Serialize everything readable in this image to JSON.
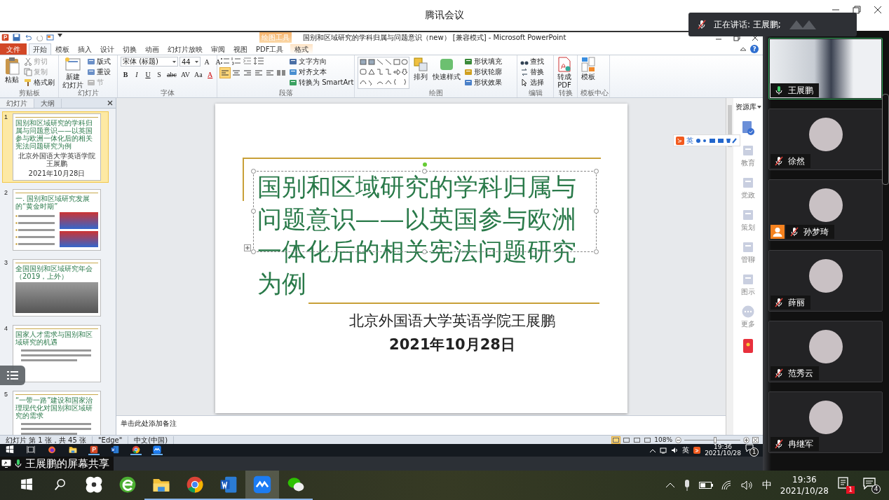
{
  "meeting": {
    "title": "腾讯会议",
    "speaking": {
      "label": "正在讲话: 王展鹏;",
      "mic_muted": true
    }
  },
  "ppt": {
    "title": "国别和区域研究的学科归属与问题意识（new） [兼容模式] - Microsoft PowerPoint",
    "context_group": "绘图工具",
    "help": "?",
    "tabs": [
      {
        "label": "文件",
        "kind": "file",
        "selected": false
      },
      {
        "label": "开始",
        "kind": "normal",
        "selected": true
      },
      {
        "label": "模板",
        "kind": "normal",
        "selected": false
      },
      {
        "label": "插入",
        "kind": "normal",
        "selected": false
      },
      {
        "label": "设计",
        "kind": "normal",
        "selected": false
      },
      {
        "label": "切换",
        "kind": "normal",
        "selected": false
      },
      {
        "label": "动画",
        "kind": "normal",
        "selected": false
      },
      {
        "label": "幻灯片放映",
        "kind": "normal",
        "selected": false
      },
      {
        "label": "审阅",
        "kind": "normal",
        "selected": false
      },
      {
        "label": "视图",
        "kind": "normal",
        "selected": false
      },
      {
        "label": "PDF工具",
        "kind": "normal",
        "selected": false
      },
      {
        "label": "格式",
        "kind": "context",
        "selected": false
      }
    ],
    "ribbon": {
      "clipboard": {
        "label": "剪贴板",
        "paste": "粘贴",
        "items": [
          {
            "label": "剪切",
            "disabled": true
          },
          {
            "label": "复制",
            "disabled": true
          },
          {
            "label": "格式刷",
            "disabled": false
          }
        ]
      },
      "slides": {
        "label": "幻灯片",
        "new_slide": [
          "新建",
          "幻灯片"
        ],
        "items": [
          {
            "label": "版式",
            "disabled": false
          },
          {
            "label": "重设",
            "disabled": false
          },
          {
            "label": "节",
            "disabled": true
          }
        ]
      },
      "font": {
        "label": "字体",
        "name": "宋体 (标题)",
        "size": "44",
        "size_buttons": [
          "A",
          "A"
        ],
        "buttons": [
          "B",
          "I",
          "U",
          "S",
          "abc",
          "AV",
          "Aa",
          "A"
        ]
      },
      "paragraph": {
        "label": "段落",
        "alignments": [
          {
            "selected": true
          },
          {
            "selected": false
          },
          {
            "selected": false
          },
          {
            "selected": false
          },
          {
            "selected": false
          }
        ],
        "items": [
          {
            "label": "文字方向"
          },
          {
            "label": "对齐文本"
          },
          {
            "label": "转换为 SmartArt"
          }
        ]
      },
      "drawing": {
        "label": "绘图",
        "large": [
          "排列",
          "快速样式"
        ],
        "items": [
          {
            "label": "形状填充"
          },
          {
            "label": "形状轮廓"
          },
          {
            "label": "形状效果"
          }
        ]
      },
      "editing": {
        "label": "编辑",
        "items": [
          {
            "label": "查找"
          },
          {
            "label": "替换"
          },
          {
            "label": "选择"
          }
        ]
      },
      "convert": {
        "label": "转换",
        "button": [
          "转成",
          "PDF"
        ]
      },
      "template": {
        "label": "模板中心",
        "button": "模板"
      }
    },
    "pane": {
      "tabs": [
        {
          "label": "幻灯片",
          "selected": true
        },
        {
          "label": "大纲",
          "selected": false
        }
      ],
      "thumbnails": [
        {
          "number": "1",
          "kind": "title",
          "selected": true,
          "title": "国别和区域研究的学科归属与问题意识——以英国参与欧洲一体化后的相关宪法问题研究为例",
          "lines": [
            "北京外国语大学英语学院王展鹏",
            "2021年10月28日"
          ]
        },
        {
          "number": "2",
          "kind": "photos",
          "selected": false,
          "title": "一. 国别和区域研究发展的“黄金时期”"
        },
        {
          "number": "3",
          "kind": "photo",
          "selected": false,
          "title": "全国国别和区域研究年会（2019，上外）"
        },
        {
          "number": "4",
          "kind": "text",
          "selected": false,
          "title": "国家人才需求与国别和区域研究的机遇"
        },
        {
          "number": "5",
          "kind": "text",
          "selected": false,
          "title": "“一带一路”建设和国家治理现代化对国别和区域研究的需求"
        }
      ]
    },
    "slide": {
      "title": "国别和区域研究的学科归属与问题意识——以英国参与欧洲一体化后的相关宪法问题研究为例",
      "subtitle": "北京外国语大学英语学院王展鹏",
      "date": "2021年10月28日"
    },
    "notes_placeholder": "单击此处添加备注",
    "library": {
      "title": "资源库",
      "items": [
        {
          "label": "教育"
        },
        {
          "label": "党政"
        },
        {
          "label": "策划"
        },
        {
          "label": "管聊"
        },
        {
          "label": "图示"
        },
        {
          "label": "更多"
        }
      ]
    },
    "status": {
      "items": [
        "幻灯片 第 1 张，共 45 张",
        "\"Edge\"",
        "中文(中国)"
      ],
      "views": [
        {
          "selected": true
        },
        {
          "selected": false
        },
        {
          "selected": false
        },
        {
          "selected": false
        }
      ],
      "zoom": "108%",
      "zoom_slider": {
        "level": 0.55
      }
    },
    "ime_toolbar": {
      "label": "英"
    }
  },
  "remote_taskbar": {
    "apps": [
      {
        "kind": "start",
        "running": false
      },
      {
        "kind": "taskview",
        "running": false
      },
      {
        "kind": "firefox",
        "running": false
      },
      {
        "kind": "folder",
        "running": false
      },
      {
        "kind": "ppt",
        "running": true
      },
      {
        "kind": "word",
        "running": false
      },
      {
        "kind": "chrome",
        "running": true
      },
      {
        "kind": "meeting",
        "running": true
      }
    ],
    "ime": "英",
    "time": "19:36",
    "date": "2021/10/28",
    "notifications": "1"
  },
  "share_label": "王展鹏的屏幕共享",
  "participants": [
    {
      "name": "王展鹏",
      "kind": "video",
      "muted": false,
      "speaking": true,
      "role_badge": false
    },
    {
      "name": "徐然",
      "kind": "avatar",
      "muted": true,
      "speaking": false,
      "role_badge": false
    },
    {
      "name": "孙梦琦",
      "kind": "avatar",
      "muted": true,
      "speaking": false,
      "role_badge": true
    },
    {
      "name": "薛丽",
      "kind": "avatar",
      "muted": true,
      "speaking": false,
      "role_badge": false
    },
    {
      "name": "范秀云",
      "kind": "avatar",
      "muted": true,
      "speaking": false,
      "role_badge": false
    },
    {
      "name": "冉继军",
      "kind": "avatar",
      "muted": true,
      "speaking": false,
      "role_badge": false
    }
  ],
  "taskbar": {
    "apps": [
      {
        "kind": "start",
        "running": false,
        "selected": false
      },
      {
        "kind": "search",
        "running": false,
        "selected": false
      },
      {
        "kind": "pinwheel",
        "running": false,
        "selected": false
      },
      {
        "kind": "ie",
        "running": false,
        "selected": false
      },
      {
        "kind": "folder",
        "running": true,
        "selected": false
      },
      {
        "kind": "chrome",
        "running": true,
        "selected": false
      },
      {
        "kind": "word",
        "running": true,
        "selected": false
      },
      {
        "kind": "meeting",
        "running": true,
        "selected": true
      },
      {
        "kind": "wechat",
        "running": true,
        "selected": false
      }
    ],
    "ime": "中",
    "time": "19:36",
    "date": "2021/10/28",
    "notifications": "1",
    "chat": "4"
  }
}
